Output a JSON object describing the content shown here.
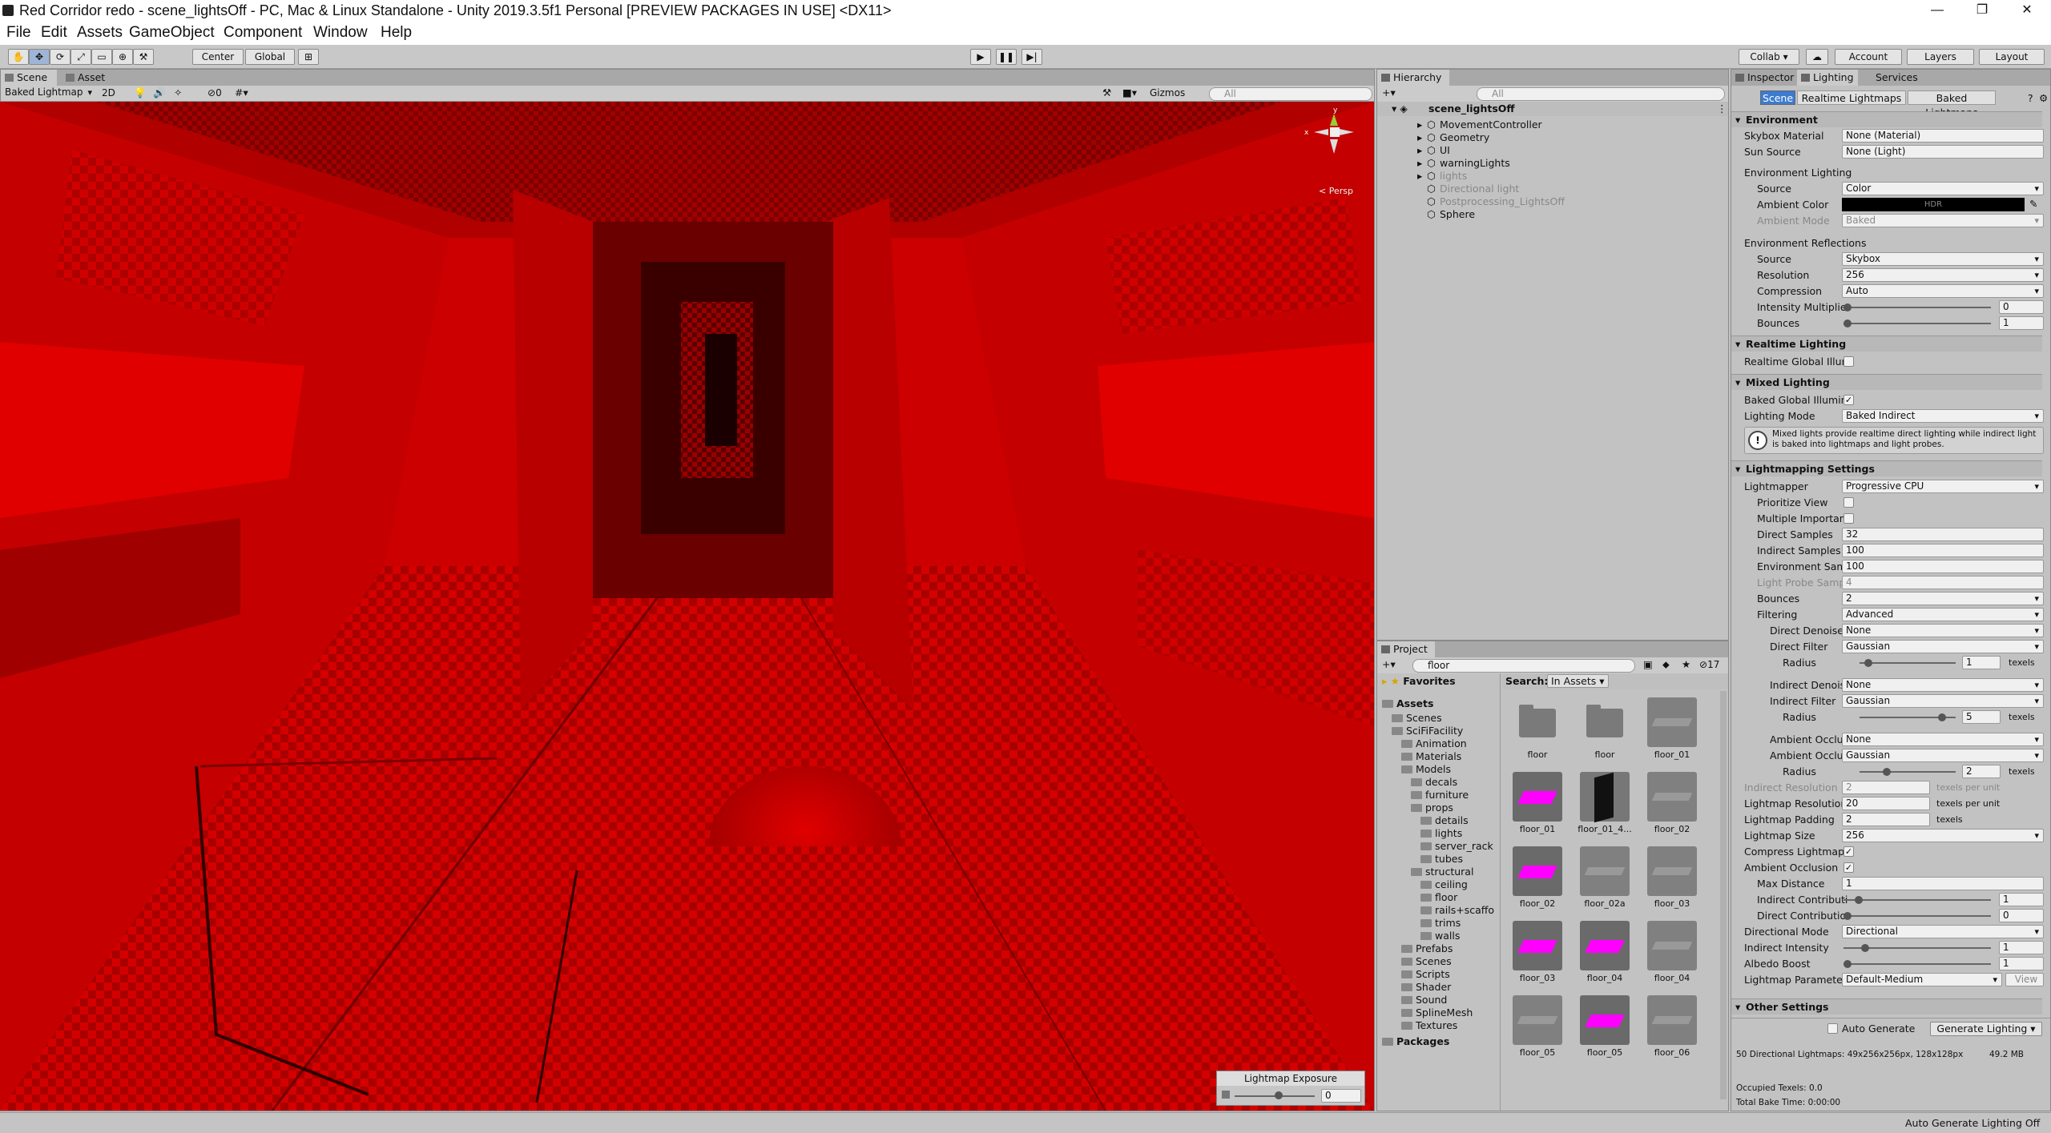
{
  "window": {
    "title": "Red Corridor redo - scene_lightsOff - PC, Mac & Linux Standalone - Unity 2019.3.5f1 Personal [PREVIEW PACKAGES IN USE] <DX11>"
  },
  "menu": [
    "File",
    "Edit",
    "Assets",
    "GameObject",
    "Component",
    "Window",
    "Help"
  ],
  "toolbar": {
    "center": "Center",
    "global": "Global",
    "collab": "Collab ▾",
    "account": "Account",
    "layers": "Layers",
    "layout": "Layout"
  },
  "scene": {
    "tabs": [
      "Scene",
      "Asset Store"
    ],
    "draw_mode": "Baked Lightmap",
    "two_d": "2D",
    "fx_count": "0",
    "gizmos": "Gizmos",
    "search_placeholder": "All",
    "persp": "< Persp",
    "lightmap_exposure": {
      "label": "Lightmap Exposure",
      "value": "0"
    }
  },
  "hierarchy": {
    "tab": "Hierarchy",
    "search_placeholder": "All",
    "scene_name": "scene_lightsOff",
    "items": [
      {
        "name": "MovementController",
        "dim": false
      },
      {
        "name": "Geometry",
        "dim": false
      },
      {
        "name": "UI",
        "dim": false
      },
      {
        "name": "warningLights",
        "dim": false
      },
      {
        "name": "lights",
        "dim": true
      },
      {
        "name": "Directional light",
        "dim": true
      },
      {
        "name": "Postprocessing_LightsOff",
        "dim": true
      },
      {
        "name": "Sphere",
        "dim": false
      }
    ]
  },
  "project": {
    "tab": "Project",
    "search_value": "floor",
    "count": "17",
    "search_label": "Search:",
    "search_scope": "In Assets",
    "favorites": "Favorites",
    "tree": [
      {
        "name": "Assets",
        "bold": true
      },
      {
        "name": "Scenes"
      },
      {
        "name": "SciFiFacility"
      },
      {
        "name": "Animation"
      },
      {
        "name": "Materials"
      },
      {
        "name": "Models"
      },
      {
        "name": "decals"
      },
      {
        "name": "furniture"
      },
      {
        "name": "props"
      },
      {
        "name": "details"
      },
      {
        "name": "lights"
      },
      {
        "name": "server_rack"
      },
      {
        "name": "tubes"
      },
      {
        "name": "structural"
      },
      {
        "name": "ceiling"
      },
      {
        "name": "floor"
      },
      {
        "name": "rails+scaffo"
      },
      {
        "name": "trims"
      },
      {
        "name": "walls"
      },
      {
        "name": "Prefabs"
      },
      {
        "name": "Scenes"
      },
      {
        "name": "Scripts"
      },
      {
        "name": "Shader"
      },
      {
        "name": "Sound"
      },
      {
        "name": "SplineMesh"
      },
      {
        "name": "Textures"
      },
      {
        "name": "Packages",
        "bold": true
      }
    ],
    "assets": [
      {
        "label": "floor",
        "kind": "folder"
      },
      {
        "label": "floor",
        "kind": "folder"
      },
      {
        "label": "floor_01",
        "kind": "mesh"
      },
      {
        "label": "floor_01",
        "kind": "material"
      },
      {
        "label": "floor_01_4...",
        "kind": "dark"
      },
      {
        "label": "floor_02",
        "kind": "mesh"
      },
      {
        "label": "floor_02",
        "kind": "material"
      },
      {
        "label": "floor_02a",
        "kind": "mesh"
      },
      {
        "label": "floor_03",
        "kind": "mesh"
      },
      {
        "label": "floor_03",
        "kind": "material"
      },
      {
        "label": "floor_04",
        "kind": "material"
      },
      {
        "label": "floor_04",
        "kind": "mesh"
      },
      {
        "label": "floor_05",
        "kind": "mesh"
      },
      {
        "label": "floor_05",
        "kind": "material"
      },
      {
        "label": "floor_06",
        "kind": "mesh"
      }
    ]
  },
  "inspector": {
    "tabs": [
      "Inspector",
      "Lighting",
      "Services"
    ],
    "subtabs": [
      "Scene",
      "Realtime Lightmaps",
      "Baked Lightmaps"
    ],
    "environment": {
      "header": "Environment",
      "skybox_material": {
        "label": "Skybox Material",
        "value": "None (Material)"
      },
      "sun_source": {
        "label": "Sun Source",
        "value": "None (Light)"
      },
      "env_lighting": "Environment Lighting",
      "source": {
        "label": "Source",
        "value": "Color"
      },
      "ambient_color": {
        "label": "Ambient Color",
        "value": "HDR"
      },
      "ambient_mode": {
        "label": "Ambient Mode",
        "value": "Baked"
      },
      "env_reflections": "Environment Reflections",
      "refl_source": {
        "label": "Source",
        "value": "Skybox"
      },
      "resolution": {
        "label": "Resolution",
        "value": "256"
      },
      "compression": {
        "label": "Compression",
        "value": "Auto"
      },
      "intensity": {
        "label": "Intensity Multiplier",
        "value": "0"
      },
      "bounces": {
        "label": "Bounces",
        "value": "1"
      }
    },
    "realtime": {
      "header": "Realtime Lighting",
      "gi": "Realtime Global Illum"
    },
    "mixed": {
      "header": "Mixed Lighting",
      "baked_gi": "Baked Global Illumin",
      "lighting_mode": {
        "label": "Lighting Mode",
        "value": "Baked Indirect"
      },
      "help": "Mixed lights provide realtime direct lighting while indirect light is baked into lightmaps and light probes."
    },
    "lightmapping": {
      "header": "Lightmapping Settings",
      "lightmapper": {
        "label": "Lightmapper",
        "value": "Progressive CPU"
      },
      "prioritize_view": "Prioritize View",
      "multiple_importance": "Multiple Importanc",
      "direct_samples": {
        "label": "Direct Samples",
        "value": "32"
      },
      "indirect_samples": {
        "label": "Indirect Samples",
        "value": "100"
      },
      "environment_samples": {
        "label": "Environment Samp",
        "value": "100"
      },
      "light_probe_samples": {
        "label": "Light Probe Sampl",
        "value": "4"
      },
      "bounces": {
        "label": "Bounces",
        "value": "2"
      },
      "filtering": {
        "label": "Filtering",
        "value": "Advanced"
      },
      "direct_denoiser": {
        "label": "Direct Denoiser",
        "value": "None"
      },
      "direct_filter": {
        "label": "Direct Filter",
        "value": "Gaussian"
      },
      "radius1": {
        "label": "Radius",
        "value": "1",
        "unit": "texels"
      },
      "indirect_denoiser": {
        "label": "Indirect Denoise",
        "value": "None"
      },
      "indirect_filter": {
        "label": "Indirect Filter",
        "value": "Gaussian"
      },
      "radius2": {
        "label": "Radius",
        "value": "5",
        "unit": "texels"
      },
      "ao_denoiser": {
        "label": "Ambient Occlus",
        "value": "None"
      },
      "ao_filter": {
        "label": "Ambient Occlus",
        "value": "Gaussian"
      },
      "radius3": {
        "label": "Radius",
        "value": "2",
        "unit": "texels"
      },
      "indirect_resolution": {
        "label": "Indirect Resolution",
        "value": "2",
        "unit": "texels per unit"
      },
      "lightmap_resolution": {
        "label": "Lightmap Resolution",
        "value": "20",
        "unit": "texels per unit"
      },
      "lightmap_padding": {
        "label": "Lightmap Padding",
        "value": "2",
        "unit": "texels"
      },
      "lightmap_size": {
        "label": "Lightmap Size",
        "value": "256"
      },
      "compress_lightmaps": "Compress Lightmaps",
      "ambient_occlusion": "Ambient Occlusion",
      "max_distance": {
        "label": "Max Distance",
        "value": "1"
      },
      "indirect_contribution": {
        "label": "Indirect Contributi",
        "value": "1"
      },
      "direct_contribution": {
        "label": "Direct Contributio",
        "value": "0"
      },
      "directional_mode": {
        "label": "Directional Mode",
        "value": "Directional"
      },
      "indirect_intensity": {
        "label": "Indirect Intensity",
        "value": "1"
      },
      "albedo_boost": {
        "label": "Albedo Boost",
        "value": "1"
      },
      "lightmap_parameters": {
        "label": "Lightmap Parameters",
        "value": "Default-Medium",
        "view": "View"
      }
    },
    "other": {
      "header": "Other Settings"
    },
    "auto_generate": "Auto Generate",
    "generate_lighting": "Generate Lighting",
    "stats": "50 Directional Lightmaps: 49x256x256px, 128x128px",
    "stats_size": "49.2 MB",
    "occupied": "Occupied Texels: 0.0",
    "bake_time": "Total Bake Time: 0:00:00"
  },
  "status": {
    "right": "Auto Generate Lighting Off"
  },
  "colors": {
    "scene_red": "#cc0000",
    "magenta": "#ff00ff",
    "panel_bg": "#c2c2c2"
  }
}
